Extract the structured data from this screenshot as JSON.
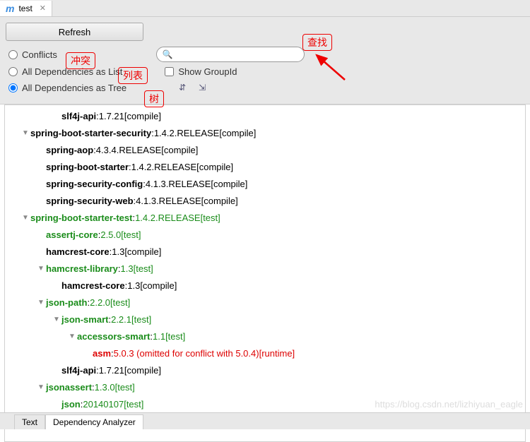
{
  "tab": {
    "title": "test"
  },
  "toolbar": {
    "refresh": "Refresh",
    "conflicts": "Conflicts",
    "asList": "All Dependencies as List",
    "asTree": "All Dependencies as Tree",
    "showGroupId": "Show GroupId",
    "searchPlaceholder": ""
  },
  "annotations": {
    "conflict": "冲突",
    "list": "列表",
    "tree": "树",
    "search": "查找"
  },
  "bottomTabs": {
    "text": "Text",
    "analyzer": "Dependency Analyzer"
  },
  "watermark": "https://blog.csdn.net/lizhiyuan_eagle",
  "tree": [
    {
      "indent": 3,
      "arrow": "",
      "cls": "",
      "name": "slf4j-api",
      "ver": "1.7.21",
      "scope": "[compile]"
    },
    {
      "indent": 1,
      "arrow": "▼",
      "cls": "",
      "name": "spring-boot-starter-security",
      "ver": "1.4.2.RELEASE",
      "scope": "[compile]"
    },
    {
      "indent": 2,
      "arrow": "",
      "cls": "",
      "name": "spring-aop",
      "ver": "4.3.4.RELEASE",
      "scope": "[compile]"
    },
    {
      "indent": 2,
      "arrow": "",
      "cls": "",
      "name": "spring-boot-starter",
      "ver": "1.4.2.RELEASE",
      "scope": "[compile]"
    },
    {
      "indent": 2,
      "arrow": "",
      "cls": "",
      "name": "spring-security-config",
      "ver": "4.1.3.RELEASE",
      "scope": "[compile]"
    },
    {
      "indent": 2,
      "arrow": "",
      "cls": "",
      "name": "spring-security-web",
      "ver": "4.1.3.RELEASE",
      "scope": "[compile]"
    },
    {
      "indent": 1,
      "arrow": "▼",
      "cls": "test",
      "name": "spring-boot-starter-test",
      "ver": "1.4.2.RELEASE",
      "scope": "[test]"
    },
    {
      "indent": 2,
      "arrow": "",
      "cls": "test",
      "name": "assertj-core",
      "ver": "2.5.0",
      "scope": "[test]"
    },
    {
      "indent": 2,
      "arrow": "",
      "cls": "",
      "name": "hamcrest-core",
      "ver": "1.3",
      "scope": "[compile]"
    },
    {
      "indent": 2,
      "arrow": "▼",
      "cls": "test",
      "name": "hamcrest-library",
      "ver": "1.3",
      "scope": "[test]"
    },
    {
      "indent": 3,
      "arrow": "",
      "cls": "",
      "name": "hamcrest-core",
      "ver": "1.3",
      "scope": "[compile]"
    },
    {
      "indent": 2,
      "arrow": "▼",
      "cls": "test",
      "name": "json-path",
      "ver": "2.2.0",
      "scope": "[test]"
    },
    {
      "indent": 3,
      "arrow": "▼",
      "cls": "test",
      "name": "json-smart",
      "ver": "2.2.1",
      "scope": "[test]"
    },
    {
      "indent": 4,
      "arrow": "▼",
      "cls": "test",
      "name": "accessors-smart",
      "ver": "1.1",
      "scope": "[test]"
    },
    {
      "indent": 5,
      "arrow": "",
      "cls": "conflict",
      "name": "asm",
      "ver": "5.0.3 (omitted for conflict with 5.0.4)",
      "scope": "[runtime]"
    },
    {
      "indent": 3,
      "arrow": "",
      "cls": "",
      "name": "slf4j-api",
      "ver": "1.7.21",
      "scope": "[compile]"
    },
    {
      "indent": 2,
      "arrow": "▼",
      "cls": "test",
      "name": "jsonassert",
      "ver": "1.3.0",
      "scope": "[test]"
    },
    {
      "indent": 3,
      "arrow": "",
      "cls": "test",
      "name": "json",
      "ver": "20140107",
      "scope": "[test]"
    }
  ]
}
